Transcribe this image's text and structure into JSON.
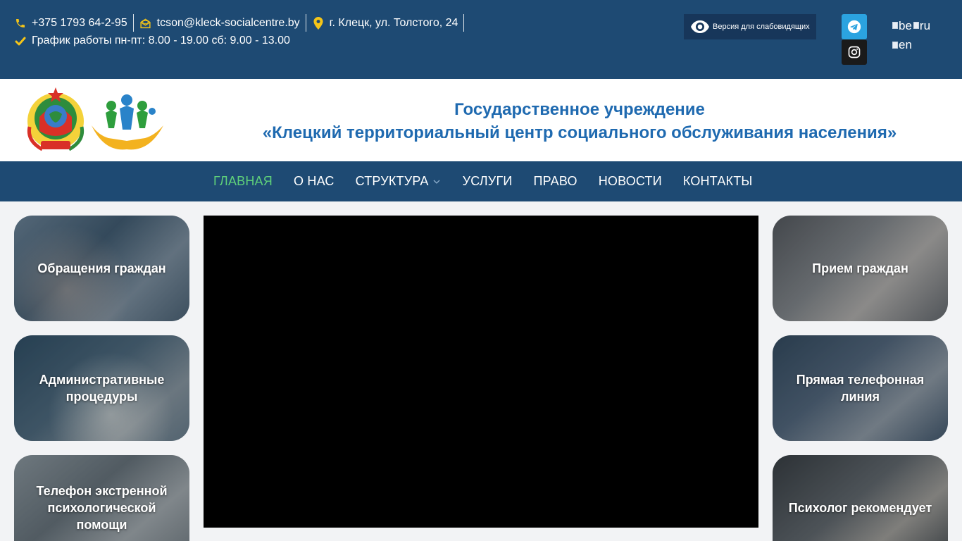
{
  "topbar": {
    "phone": "+375 1793 64-2-95",
    "email": "tcson@kleck-socialcentre.by",
    "address": "г. Клецк, ул. Толстого, 24",
    "hours": "График работы пн-пт: 8.00 - 19.00 сб: 9.00 - 13.00",
    "vision_label": "Версия для слабовидящих",
    "languages": [
      {
        "code": "be"
      },
      {
        "code": "ru"
      },
      {
        "code": "en"
      }
    ],
    "colors": {
      "bar": "#1e4a73",
      "accent_icon": "#f5c518"
    }
  },
  "header": {
    "title_line1": "Государственное учреждение",
    "title_line2": "«Клецкий территориальный центр социального обслуживания населения»"
  },
  "nav": {
    "items": [
      {
        "label": "ГЛАВНАЯ",
        "active": true
      },
      {
        "label": "О НАС"
      },
      {
        "label": "СТРУКТУРА",
        "has_dropdown": true
      },
      {
        "label": "УСЛУГИ"
      },
      {
        "label": "ПРАВО"
      },
      {
        "label": "НОВОСТИ"
      },
      {
        "label": "КОНТАКТЫ"
      }
    ],
    "active_color": "#5fd17a"
  },
  "left_cards": [
    {
      "label": "Обращения граждан"
    },
    {
      "label": "Административные процедуры"
    },
    {
      "label": "Телефон экстренной психологической помощи"
    }
  ],
  "right_cards": [
    {
      "label": "Прием граждан"
    },
    {
      "label": "Прямая телефонная линия"
    },
    {
      "label": "Психолог рекомендует"
    }
  ]
}
